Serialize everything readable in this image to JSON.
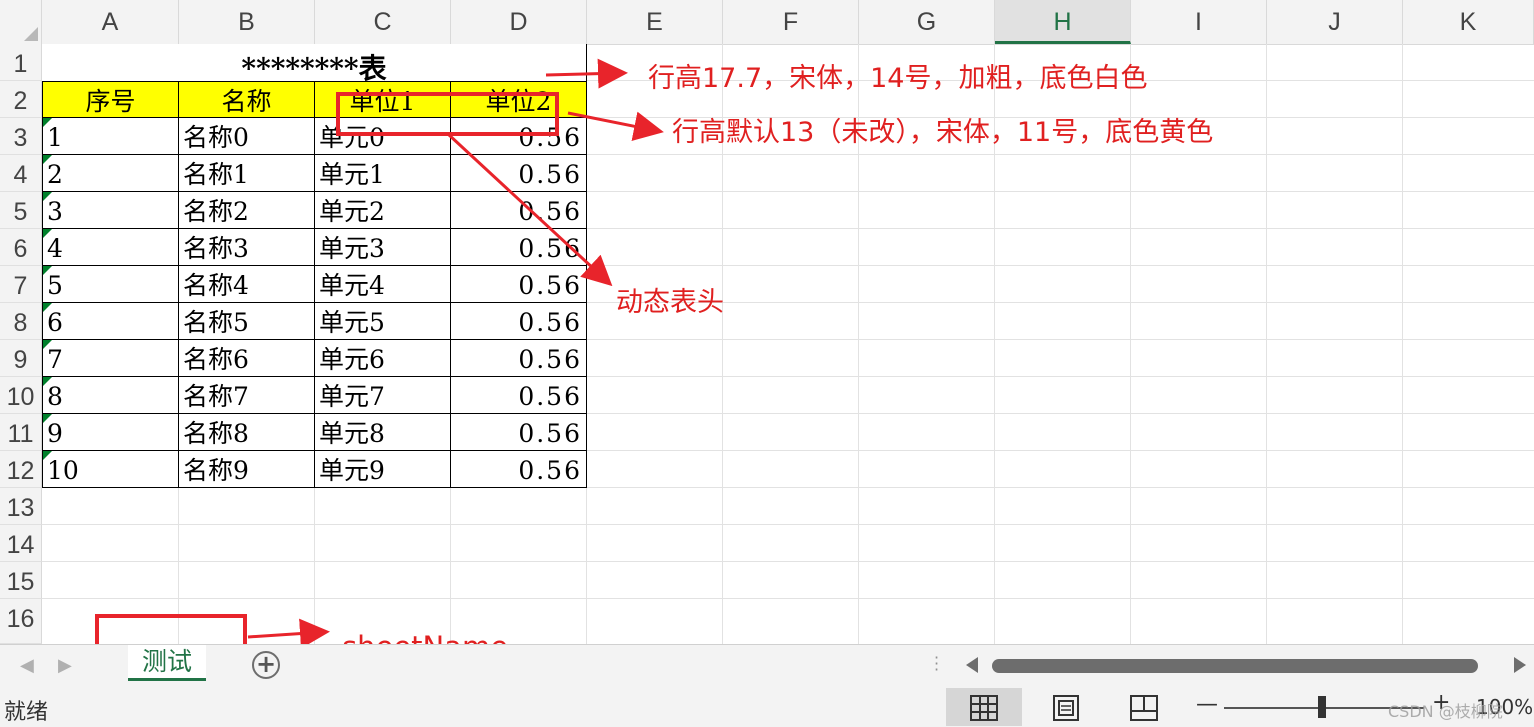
{
  "columns": [
    "A",
    "B",
    "C",
    "D",
    "E",
    "F",
    "G",
    "H",
    "I",
    "J",
    "K"
  ],
  "active_column": "H",
  "rows": [
    "1",
    "2",
    "3",
    "4",
    "5",
    "6",
    "7",
    "8",
    "9",
    "10",
    "11",
    "12",
    "13",
    "14",
    "15",
    "16"
  ],
  "sheet": {
    "title": "********表",
    "headers": [
      "序号",
      "名称",
      "单位1",
      "单位2"
    ],
    "header_fill": "#ffff00",
    "data": [
      {
        "seq": "1",
        "name": "名称0",
        "unit": "单元0",
        "value": "0.56"
      },
      {
        "seq": "2",
        "name": "名称1",
        "unit": "单元1",
        "value": "0.56"
      },
      {
        "seq": "3",
        "name": "名称2",
        "unit": "单元2",
        "value": "0.56"
      },
      {
        "seq": "4",
        "name": "名称3",
        "unit": "单元3",
        "value": "0.56"
      },
      {
        "seq": "5",
        "name": "名称4",
        "unit": "单元4",
        "value": "0.56"
      },
      {
        "seq": "6",
        "name": "名称5",
        "unit": "单元5",
        "value": "0.56"
      },
      {
        "seq": "7",
        "name": "名称6",
        "unit": "单元6",
        "value": "0.56"
      },
      {
        "seq": "8",
        "name": "名称7",
        "unit": "单元7",
        "value": "0.56"
      },
      {
        "seq": "9",
        "name": "名称8",
        "unit": "单元8",
        "value": "0.56"
      },
      {
        "seq": "10",
        "name": "名称9",
        "unit": "单元9",
        "value": "0.56"
      }
    ]
  },
  "annotations": {
    "row1_note": "行高17.7，宋体，14号，加粗，底色白色",
    "row2_note": "行高默认13（未改），宋体，11号，底色黄色",
    "dynamic_header": "动态表头",
    "sheet_name": "sheetName",
    "color": "#e02020"
  },
  "tabs": {
    "active_sheet": "测试",
    "add_icon": "plus-circle-icon"
  },
  "status": {
    "text": "就绪",
    "zoom": "100%",
    "watermark": "CSDN @枝柳院"
  },
  "accent": "#217346"
}
